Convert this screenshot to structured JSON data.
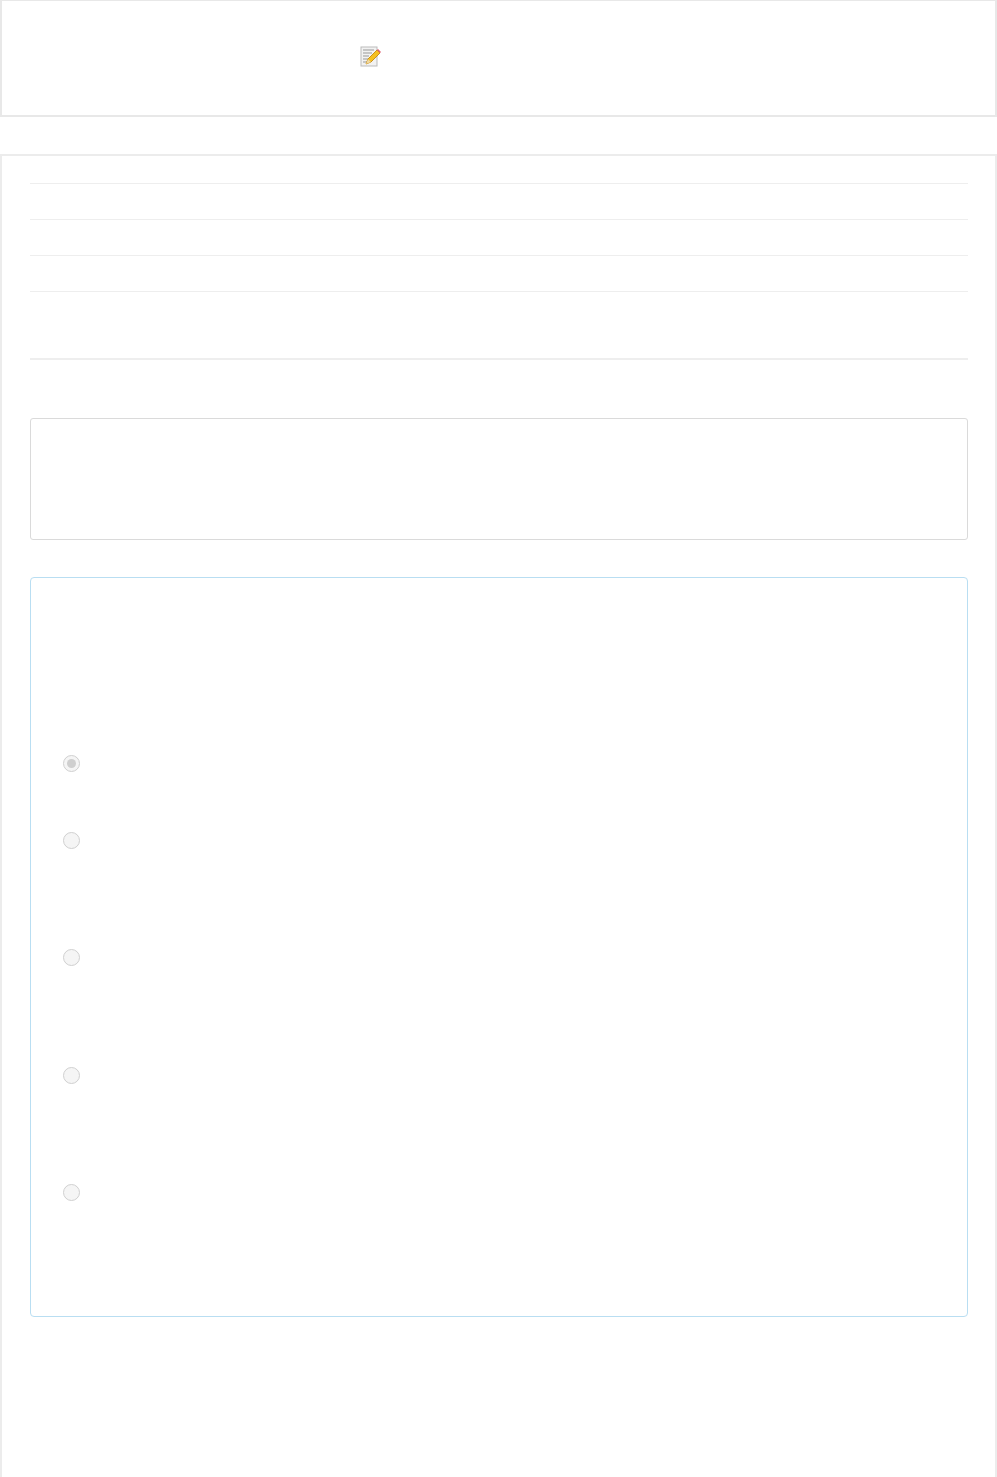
{
  "question": {
    "options": [
      {
        "selected": true
      },
      {
        "selected": false
      },
      {
        "selected": false
      },
      {
        "selected": false
      },
      {
        "selected": false
      }
    ]
  }
}
